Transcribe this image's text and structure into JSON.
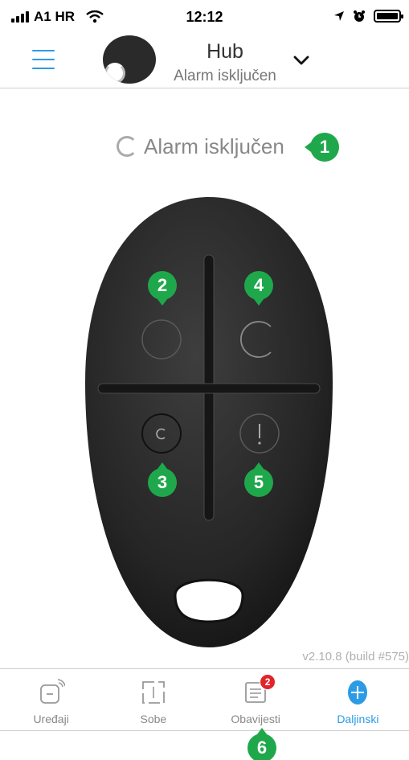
{
  "status_bar": {
    "carrier": "A1 HR",
    "time": "12:12",
    "icons": [
      "signal-icon",
      "wifi-icon",
      "location-icon",
      "alarm-clock-icon",
      "battery-icon"
    ]
  },
  "header": {
    "title": "Hub",
    "subtitle": "Alarm isključen",
    "menu_icon": "hamburger-menu-icon",
    "dropdown_icon": "chevron-down-icon"
  },
  "main": {
    "alarm_status": "Alarm isključen",
    "version": "v2.10.8 (build #575)",
    "callouts": [
      "1",
      "2",
      "3",
      "4",
      "5",
      "6"
    ]
  },
  "tabs": [
    {
      "label": "Uređaji",
      "icon": "device-icon",
      "active": false
    },
    {
      "label": "Sobe",
      "icon": "room-icon",
      "active": false
    },
    {
      "label": "Obavijesti",
      "icon": "notifications-icon",
      "active": false,
      "badge": "2"
    },
    {
      "label": "Daljinski",
      "icon": "remote-control-icon",
      "active": true
    }
  ],
  "colors": {
    "accent": "#2c9be6",
    "callout": "#1fa84b",
    "badge": "#e0242a",
    "keyfob": "#2b2b2b"
  }
}
